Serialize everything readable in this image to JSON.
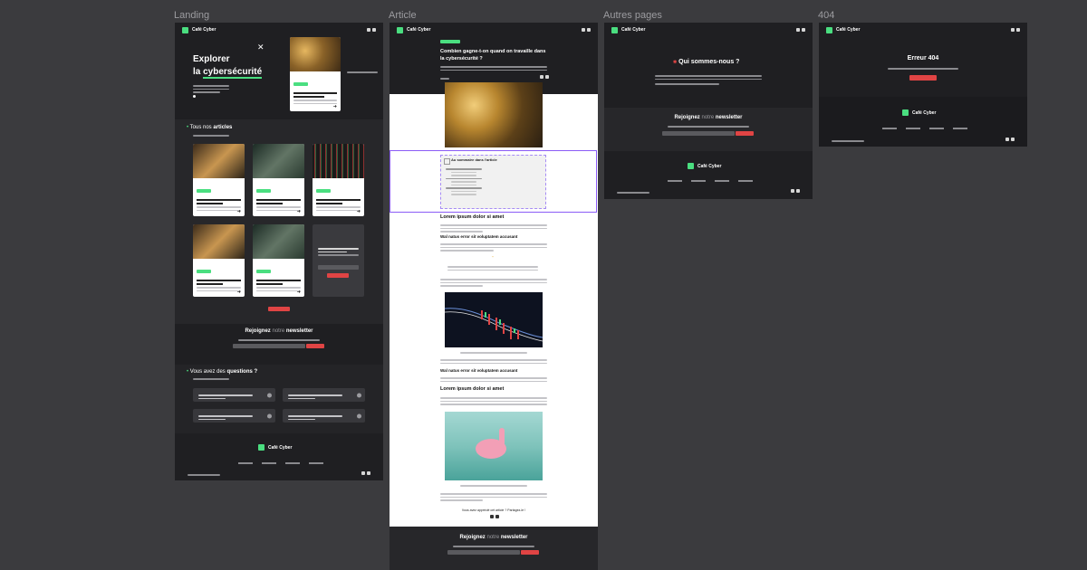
{
  "labels": {
    "landing": "Landing",
    "article": "Article",
    "autres": "Autres pages",
    "e404": "404"
  },
  "brand": "Café Cyber",
  "landing": {
    "hero_title_1": "Explorer",
    "hero_title_2": "la ",
    "hero_title_highlight": "cybersécurité",
    "articles_heading_1": "Tous nos ",
    "articles_heading_2": "articles",
    "newsletter_1": "Rejoignez ",
    "newsletter_2": "notre ",
    "newsletter_3": "newsletter",
    "questions_1": "Vous avez des ",
    "questions_2": "questions ?",
    "footer_brand": "Café Cyber"
  },
  "article": {
    "title": "Combien gagne-t-on quand on travaille dans la cybersécurité ?",
    "toc_title": "Au sommaire dans l'article",
    "h2_1": "Lorem ipsum dolor si amet",
    "h3_1": "Wal natus error sit voluptatem accusant",
    "h3_2": "Wal natus error sit voluptatem accusant",
    "h2_2": "Lorem ipsum dolor si amet",
    "share": "Vous avez apprécié cet article ? Partagez-le !",
    "newsletter_1": "Rejoignez ",
    "newsletter_2": "notre ",
    "newsletter_3": "newsletter"
  },
  "autres": {
    "title": "Qui sommes-nous ?",
    "newsletter_1": "Rejoignez ",
    "newsletter_2": "notre ",
    "newsletter_3": "newsletter",
    "footer_brand": "Café Cyber"
  },
  "e404": {
    "title": "Erreur 404",
    "footer_brand": "Café Cyber"
  },
  "colors": {
    "accent": "#4ade80",
    "cta": "#e04444",
    "selection": "#8b5cf6",
    "canvas": "#3b3b3e"
  }
}
